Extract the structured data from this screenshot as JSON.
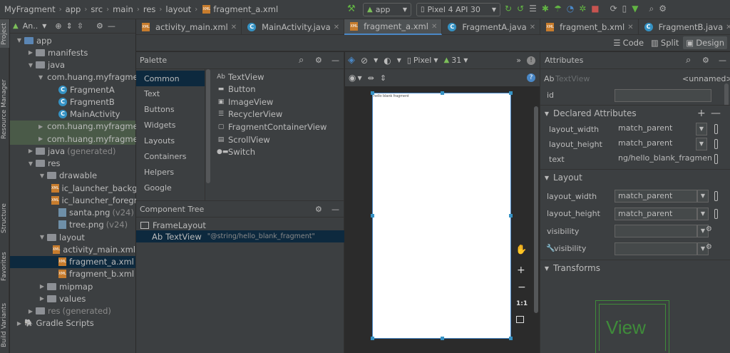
{
  "navbar": {
    "breadcrumbs": [
      "MyFragment",
      "app",
      "src",
      "main",
      "res",
      "layout",
      "fragment_a.xml"
    ],
    "run_config": "app",
    "device": "Pixel 4 API 30"
  },
  "side_tabs": [
    "Project",
    "Resource Manager",
    "Structure",
    "Favorites",
    "Build Variants"
  ],
  "project": {
    "header": "An..",
    "tree": [
      {
        "label": "app",
        "type": "folder-blue",
        "indent": 0,
        "open": true
      },
      {
        "label": "manifests",
        "type": "folder",
        "indent": 1,
        "open": false
      },
      {
        "label": "java",
        "type": "folder",
        "indent": 1,
        "open": true
      },
      {
        "label": "com.huang.myfragme",
        "type": "folder",
        "indent": 2,
        "open": true
      },
      {
        "label": "FragmentA",
        "type": "class",
        "indent": 3
      },
      {
        "label": "FragmentB",
        "type": "class",
        "indent": 3
      },
      {
        "label": "MainActivity",
        "type": "class",
        "indent": 3
      },
      {
        "label": "com.huang.myfragme",
        "type": "folder",
        "indent": 2,
        "open": false,
        "hl": true
      },
      {
        "label": "com.huang.myfragme",
        "type": "folder",
        "indent": 2,
        "open": false,
        "hl": true
      },
      {
        "label": "java",
        "suffix": "(generated)",
        "type": "folder",
        "indent": 1,
        "open": false
      },
      {
        "label": "res",
        "type": "folder",
        "indent": 1,
        "open": true
      },
      {
        "label": "drawable",
        "type": "folder",
        "indent": 2,
        "open": true
      },
      {
        "label": "ic_launcher_backg",
        "type": "xml",
        "indent": 3
      },
      {
        "label": "ic_launcher_foregr",
        "type": "xml",
        "indent": 3
      },
      {
        "label": "santa.png",
        "suffix": "(v24)",
        "type": "png",
        "indent": 3
      },
      {
        "label": "tree.png",
        "suffix": "(v24)",
        "type": "png",
        "indent": 3
      },
      {
        "label": "layout",
        "type": "folder",
        "indent": 2,
        "open": true
      },
      {
        "label": "activity_main.xml",
        "type": "xml",
        "indent": 3
      },
      {
        "label": "fragment_a.xml",
        "type": "xml",
        "indent": 3,
        "selected": true
      },
      {
        "label": "fragment_b.xml",
        "type": "xml",
        "indent": 3
      },
      {
        "label": "mipmap",
        "type": "folder",
        "indent": 2,
        "open": false
      },
      {
        "label": "values",
        "type": "folder",
        "indent": 2,
        "open": false
      },
      {
        "label": "res",
        "suffix": "(generated)",
        "type": "folder",
        "indent": 1,
        "open": false,
        "gray": true
      },
      {
        "label": "Gradle Scripts",
        "type": "gradle",
        "indent": 0,
        "open": false
      }
    ]
  },
  "tabs": [
    {
      "label": "activity_main.xml",
      "icon": "xml",
      "active": false
    },
    {
      "label": "MainActivity.java",
      "icon": "class",
      "active": false
    },
    {
      "label": "fragment_a.xml",
      "icon": "xml",
      "active": true
    },
    {
      "label": "FragmentA.java",
      "icon": "class",
      "active": false
    },
    {
      "label": "fragment_b.xml",
      "icon": "xml",
      "active": false
    },
    {
      "label": "FragmentB.java",
      "icon": "class",
      "active": false
    }
  ],
  "modes": {
    "code": "Code",
    "split": "Split",
    "design": "Design"
  },
  "palette": {
    "title": "Palette",
    "categories": [
      "Common",
      "Text",
      "Buttons",
      "Widgets",
      "Layouts",
      "Containers",
      "Helpers",
      "Google"
    ],
    "items": [
      {
        "icon": "Ab",
        "label": "TextView"
      },
      {
        "icon": "▬",
        "label": "Button"
      },
      {
        "icon": "▣",
        "label": "ImageView"
      },
      {
        "icon": "☰",
        "label": "RecyclerView"
      },
      {
        "icon": "▢",
        "label": "FragmentContainerView"
      },
      {
        "icon": "▤",
        "label": "ScrollView"
      },
      {
        "icon": "●▬",
        "label": "Switch"
      }
    ]
  },
  "component_tree": {
    "title": "Component Tree",
    "root": "FrameLayout",
    "child_prefix": "Ab",
    "child": "TextView",
    "child_value": "\"@string/hello_blank_fragment\""
  },
  "canvas": {
    "device": "Pixel",
    "api": "31",
    "preview_text": "hello blank fragment",
    "zoom_one": "1:1"
  },
  "attributes": {
    "title": "Attributes",
    "widget_prefix": "Ab",
    "widget_type": "TextView",
    "widget_name": "<unnamed>",
    "id_label": "id",
    "declared_title": "Declared Attributes",
    "declared": [
      {
        "name": "layout_width",
        "value": "match_parent"
      },
      {
        "name": "layout_height",
        "value": "match_parent"
      },
      {
        "name": "text",
        "value": "ng/hello_blank_fragment"
      }
    ],
    "layout_title": "Layout",
    "layout": [
      {
        "name": "layout_width",
        "value": "match_parent"
      },
      {
        "name": "layout_height",
        "value": "match_parent"
      },
      {
        "name": "visibility",
        "value": ""
      },
      {
        "name": "visibility",
        "value": ""
      }
    ],
    "transforms_title": "Transforms",
    "view_label": "View"
  }
}
